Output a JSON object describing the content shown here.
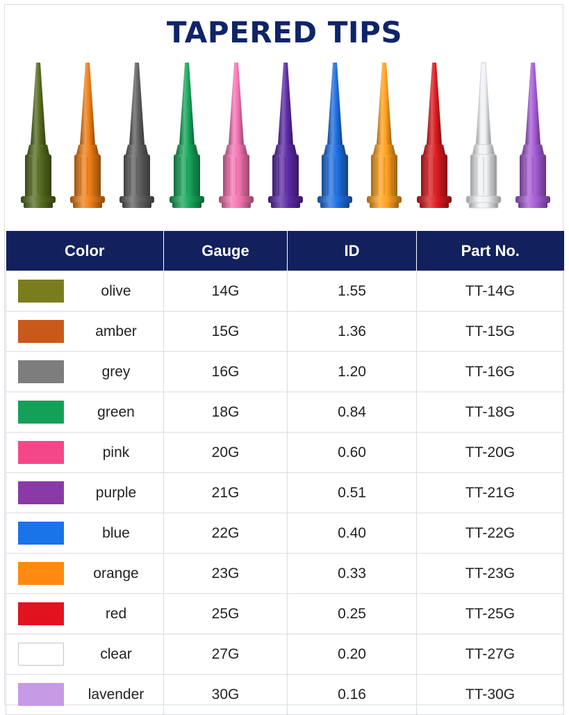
{
  "title": "TAPERED TIPS",
  "headers": {
    "color": "Color",
    "gauge": "Gauge",
    "id": "ID",
    "part": "Part No."
  },
  "rows": [
    {
      "color_name": "olive",
      "swatch": "#7a7d1e",
      "gauge": "14G",
      "id": "1.55",
      "part": "TT-14G"
    },
    {
      "color_name": "amber",
      "swatch": "#c9591a",
      "gauge": "15G",
      "id": "1.36",
      "part": "TT-15G"
    },
    {
      "color_name": "grey",
      "swatch": "#7d7d7d",
      "gauge": "16G",
      "id": "1.20",
      "part": "TT-16G"
    },
    {
      "color_name": "green",
      "swatch": "#15a05a",
      "gauge": "18G",
      "id": "0.84",
      "part": "TT-18G"
    },
    {
      "color_name": "pink",
      "swatch": "#f4478a",
      "gauge": "20G",
      "id": "0.60",
      "part": "TT-20G"
    },
    {
      "color_name": "purple",
      "swatch": "#8a3aa6",
      "gauge": "21G",
      "id": "0.51",
      "part": "TT-21G"
    },
    {
      "color_name": "blue",
      "swatch": "#1a73e8",
      "gauge": "22G",
      "id": "0.40",
      "part": "TT-22G"
    },
    {
      "color_name": "orange",
      "swatch": "#ff8a12",
      "gauge": "23G",
      "id": "0.33",
      "part": "TT-23G"
    },
    {
      "color_name": "red",
      "swatch": "#e3121f",
      "gauge": "25G",
      "id": "0.25",
      "part": "TT-25G"
    },
    {
      "color_name": "clear",
      "swatch": "#ffffff",
      "gauge": "27G",
      "id": "0.20",
      "part": "TT-27G"
    },
    {
      "color_name": "lavender",
      "swatch": "#c79ae6",
      "gauge": "30G",
      "id": "0.16",
      "part": "TT-30G"
    }
  ],
  "tip_colors": [
    "#556b1e",
    "#ee7d16",
    "#5f5f5f",
    "#17a55a",
    "#f674b3",
    "#5b2aa6",
    "#1e6fe0",
    "#ffa11e",
    "#db1a1f",
    "#f0f2f4",
    "#a65cd6"
  ]
}
